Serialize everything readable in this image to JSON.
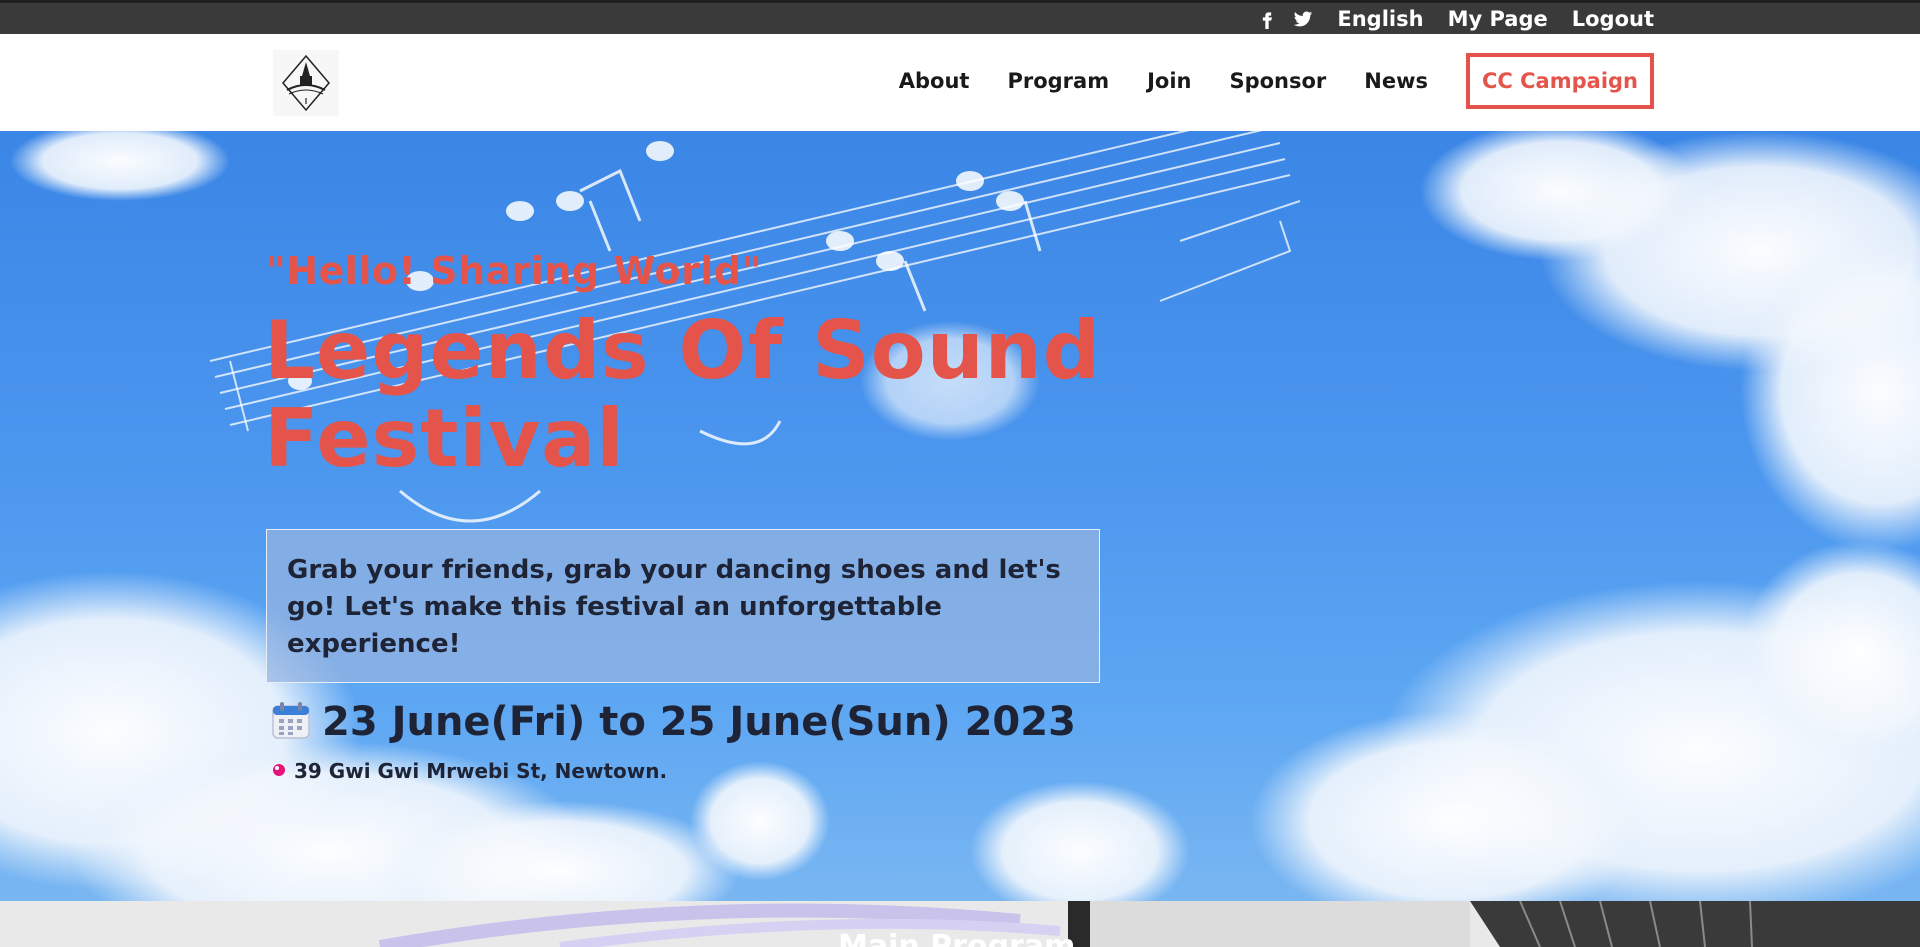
{
  "topbar": {
    "social": [
      {
        "icon": "facebook-icon"
      },
      {
        "icon": "twitter-icon"
      }
    ],
    "language": "English",
    "my_page": "My Page",
    "logout": "Logout"
  },
  "header": {
    "logo_icon": "festival-logo-icon",
    "nav": [
      {
        "label": "About"
      },
      {
        "label": "Program"
      },
      {
        "label": "Join"
      },
      {
        "label": "Sponsor"
      },
      {
        "label": "News"
      }
    ],
    "campaign": "CC Campaign"
  },
  "hero": {
    "tagline": "\"Hello! Sharing World\"",
    "title": "Legends Of Sound Festival",
    "description": "Grab your friends, grab your dancing shoes and let's go! Let's make this festival an unforgettable experience!",
    "date_icon": "calendar-icon",
    "date": "23 June(Fri) to 25 June(Sun) 2023",
    "location_icon": "location-pin-icon",
    "location": "39 Gwi Gwi Mrwebi St, Newtown."
  },
  "next_section": {
    "title": "Main Program"
  },
  "colors": {
    "accent": "#e4544a",
    "topbar": "#3a3a3a",
    "text_dark": "#1e2336",
    "sky": "#4a95ee"
  }
}
